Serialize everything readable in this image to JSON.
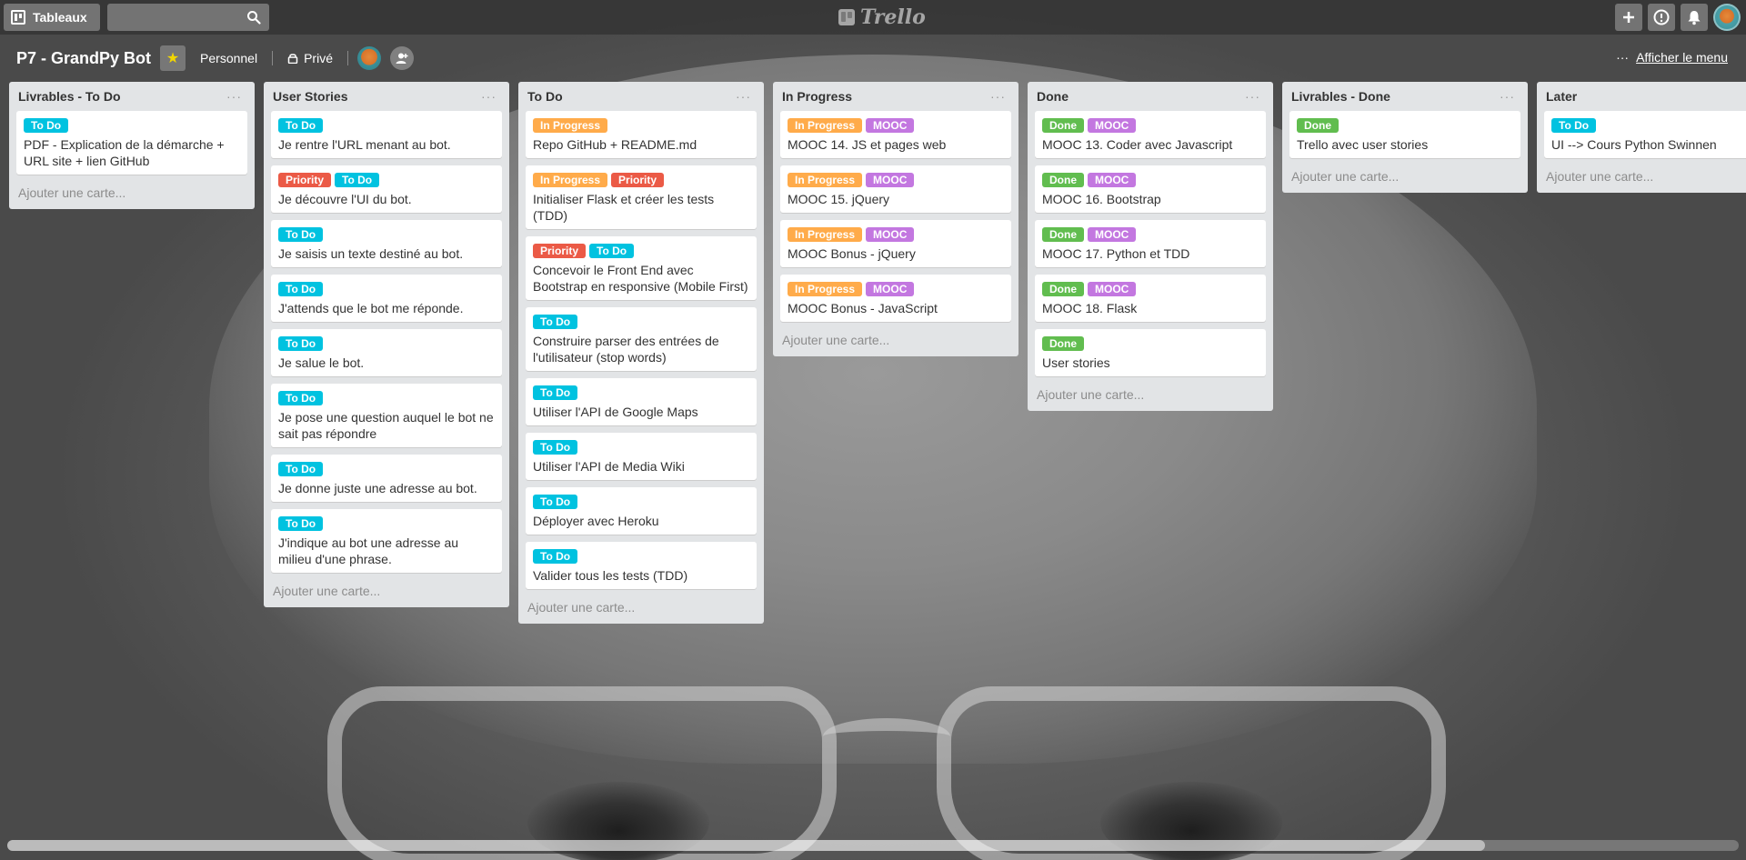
{
  "app": {
    "logo_text": "Trello"
  },
  "header": {
    "boards_label": "Tableaux",
    "search_placeholder": "",
    "search_value": ""
  },
  "board": {
    "title": "P7 - GrandPy Bot",
    "team": "Personnel",
    "visibility": "Privé",
    "show_menu_label": "Afficher le menu"
  },
  "label_colors": {
    "To Do": "#00c2e0",
    "In Progress": "#ffab4a",
    "Priority": "#eb5a46",
    "MOOC": "#c377e0",
    "Done": "#61bd4f"
  },
  "lists": [
    {
      "title": "Livrables - To Do",
      "menu": "···",
      "add_card": "Ajouter une carte...",
      "cards": [
        {
          "labels": [
            "To Do"
          ],
          "text": "PDF - Explication de la démarche + URL site + lien GitHub"
        }
      ]
    },
    {
      "title": "User Stories",
      "menu": "···",
      "add_card": "Ajouter une carte...",
      "cards": [
        {
          "labels": [
            "To Do"
          ],
          "text": "Je rentre l'URL menant au bot."
        },
        {
          "labels": [
            "Priority",
            "To Do"
          ],
          "text": "Je découvre l'UI du bot."
        },
        {
          "labels": [
            "To Do"
          ],
          "text": "Je saisis un texte destiné au bot."
        },
        {
          "labels": [
            "To Do"
          ],
          "text": "J'attends que le bot me réponde."
        },
        {
          "labels": [
            "To Do"
          ],
          "text": "Je salue le bot."
        },
        {
          "labels": [
            "To Do"
          ],
          "text": "Je pose une question auquel le bot ne sait pas répondre"
        },
        {
          "labels": [
            "To Do"
          ],
          "text": "Je donne juste une adresse au bot."
        },
        {
          "labels": [
            "To Do"
          ],
          "text": "J'indique au bot une adresse au milieu d'une phrase."
        }
      ]
    },
    {
      "title": "To Do",
      "menu": "···",
      "add_card": "Ajouter une carte...",
      "cards": [
        {
          "labels": [
            "In Progress"
          ],
          "text": "Repo GitHub + README.md"
        },
        {
          "labels": [
            "In Progress",
            "Priority"
          ],
          "text": "Initialiser Flask et créer les tests (TDD)"
        },
        {
          "labels": [
            "Priority",
            "To Do"
          ],
          "text": "Concevoir le Front End avec Bootstrap en responsive (Mobile First)"
        },
        {
          "labels": [
            "To Do"
          ],
          "text": "Construire parser des entrées de l'utilisateur (stop words)"
        },
        {
          "labels": [
            "To Do"
          ],
          "text": "Utiliser l'API de Google Maps"
        },
        {
          "labels": [
            "To Do"
          ],
          "text": "Utiliser l'API de Media Wiki"
        },
        {
          "labels": [
            "To Do"
          ],
          "text": "Déployer avec Heroku"
        },
        {
          "labels": [
            "To Do"
          ],
          "text": "Valider tous les tests (TDD)"
        }
      ]
    },
    {
      "title": "In Progress",
      "menu": "···",
      "add_card": "Ajouter une carte...",
      "cards": [
        {
          "labels": [
            "In Progress",
            "MOOC"
          ],
          "text": "MOOC 14. JS et pages web"
        },
        {
          "labels": [
            "In Progress",
            "MOOC"
          ],
          "text": "MOOC 15. jQuery"
        },
        {
          "labels": [
            "In Progress",
            "MOOC"
          ],
          "text": "MOOC Bonus - jQuery"
        },
        {
          "labels": [
            "In Progress",
            "MOOC"
          ],
          "text": "MOOC Bonus - JavaScript"
        }
      ]
    },
    {
      "title": "Done",
      "menu": "···",
      "add_card": "Ajouter une carte...",
      "cards": [
        {
          "labels": [
            "Done",
            "MOOC"
          ],
          "text": "MOOC 13. Coder avec Javascript"
        },
        {
          "labels": [
            "Done",
            "MOOC"
          ],
          "text": "MOOC 16. Bootstrap"
        },
        {
          "labels": [
            "Done",
            "MOOC"
          ],
          "text": "MOOC 17. Python et TDD"
        },
        {
          "labels": [
            "Done",
            "MOOC"
          ],
          "text": "MOOC 18. Flask"
        },
        {
          "labels": [
            "Done"
          ],
          "text": "User stories"
        }
      ]
    },
    {
      "title": "Livrables - Done",
      "menu": "···",
      "add_card": "Ajouter une carte...",
      "cards": [
        {
          "labels": [
            "Done"
          ],
          "text": "Trello avec user stories"
        }
      ]
    },
    {
      "title": "Later",
      "menu": "",
      "add_card": "Ajouter une carte...",
      "cards": [
        {
          "labels": [
            "To Do"
          ],
          "text": "UI --> Cours Python Swinnen"
        }
      ]
    }
  ]
}
